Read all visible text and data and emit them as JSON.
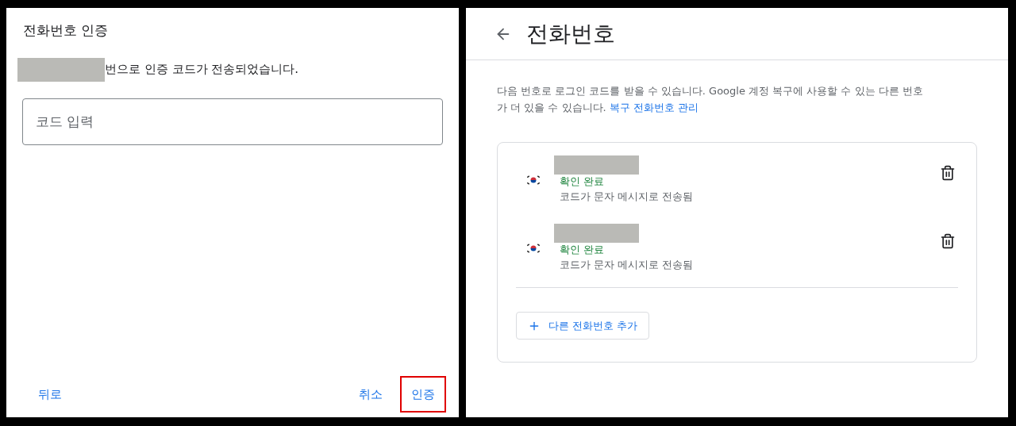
{
  "dialog": {
    "title": "전화번호 인증",
    "message": "번으로 인증 코드가 전송되었습니다.",
    "code_field": {
      "placeholder": "코드 입력"
    },
    "back_button": "뒤로",
    "buttons": [
      {
        "label": "취소",
        "highlighted": false
      },
      {
        "label": "인증",
        "highlighted": true
      }
    ]
  },
  "page": {
    "title": "전화번호",
    "description": "다음 번호로 로그인 코드를 받을 수 있습니다. Google 계정 복구에 사용할 수 있는 다른 번호가 더 있을 수 있습니다.",
    "link": "복구 전화번호 관리",
    "phones": [
      {
        "status": "확인 완료",
        "method": "코드가 문자 메시지로 전송됨"
      },
      {
        "status": "확인 완료",
        "method": "코드가 문자 메시지로 전송됨"
      }
    ],
    "add_button": "다른 전화번호 추가"
  }
}
